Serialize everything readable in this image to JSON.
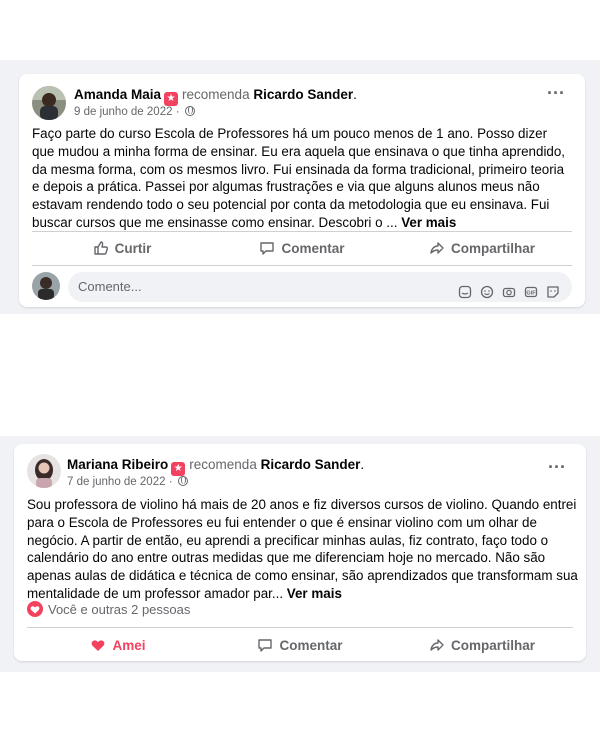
{
  "posts": [
    {
      "author": "Amanda Maia",
      "action": "recomenda",
      "target": "Ricardo Sander",
      "date": "9 de junho de 2022",
      "separator": "·",
      "text": "Faço parte do curso Escola de Professores há um pouco menos de 1 ano. Posso dizer que mudou a minha forma de ensinar. Eu era aquela que ensinava o que tinha aprendido, da mesma forma, com os mesmos livro. Fui ensinada da forma tradicional, primeiro teoria e depois a prática. Passei por algumas frustrações e via que alguns alunos meus não estavam rendendo todo o seu potencial por conta da metodologia que eu ensinava. Fui buscar cursos que me ensinasse como ensinar. Descobri o ...",
      "see_more": "Ver mais",
      "actions": {
        "like": "Curtir",
        "comment": "Comentar",
        "share": "Compartilhar"
      },
      "comment_placeholder": "Comente..."
    },
    {
      "author": "Mariana Ribeiro",
      "action": "recomenda",
      "target": "Ricardo Sander",
      "date": "7 de junho de 2022",
      "separator": "·",
      "text": "Sou professora de violino há mais de 20 anos e fiz diversos cursos de violino. Quando entrei para o Escola de Professores eu fui entender o que é ensinar violino com um olhar de negócio. A partir de então, eu aprendi a precificar minhas aulas, fiz contrato, faço todo o calendário do ano entre outras medidas que me diferenciam hoje no mercado. Não são apenas aulas de didática e técnica de como ensinar, são aprendizados que transformam sua mentalidade de um professor amador par...",
      "see_more": "Ver mais",
      "reactions": "Você e outras 2 pessoas",
      "actions": {
        "like": "Amei",
        "comment": "Comentar",
        "share": "Compartilhar"
      }
    }
  ],
  "colors": {
    "accent": "#f3425f",
    "muted": "#65676b",
    "background": "#f0f2f5"
  },
  "icons": [
    "recommend-badge-icon",
    "globe-icon",
    "more-icon",
    "like-icon",
    "comment-icon",
    "share-icon",
    "heart-icon",
    "sticker-icon",
    "emoji-icon",
    "camera-icon",
    "gif-icon"
  ]
}
